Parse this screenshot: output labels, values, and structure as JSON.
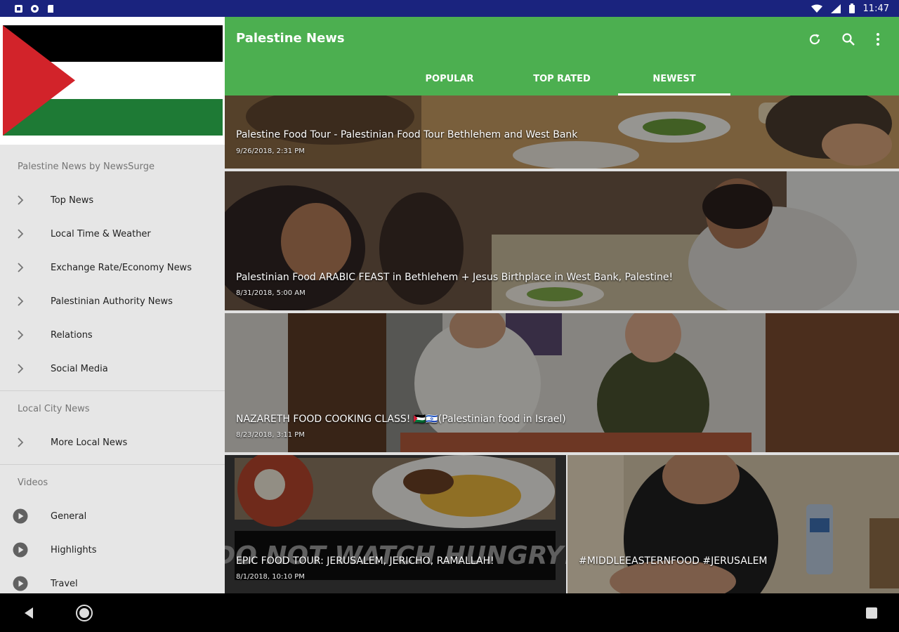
{
  "status_bar": {
    "time": "11:47"
  },
  "drawer": {
    "sections": [
      {
        "title": "Palestine News by NewsSurge",
        "items": [
          "Top News",
          "Local Time & Weather",
          "Exchange Rate/Economy News",
          "Palestinian Authority News",
          "Relations",
          "Social Media"
        ]
      },
      {
        "title": "Local City News",
        "items": [
          "More Local News"
        ]
      },
      {
        "title": "Videos",
        "items": [
          "General",
          "Highlights",
          "Travel"
        ]
      }
    ]
  },
  "app_bar": {
    "title": "Palestine News",
    "tabs": [
      "POPULAR",
      "TOP RATED",
      "NEWEST"
    ],
    "active_tab": "NEWEST",
    "accent": "#4caf50"
  },
  "feed": [
    {
      "title": "Palestine Food Tour - Palestinian Food Tour Bethlehem and West Bank",
      "date": "9/26/2018, 2:31 PM"
    },
    {
      "title": "Palestinian Food   ARABIC FEAST in Bethlehem + Jesus Birthplace in West Bank, Palestine!",
      "date": "8/31/2018, 5:00 AM"
    },
    {
      "title": "NAZARETH FOOD COOKING CLASS! 🇵🇸🇮🇱(Palestinian food in Israel)",
      "date": "8/23/2018, 3:11 PM"
    },
    {
      "title": "EPIC FOOD TOUR: JERUSALEM, JERICHO, RAMALLAH!",
      "date": "8/1/2018, 10:10 PM",
      "image_text": "DO NOT WATCH HUNGRY!"
    },
    {
      "title": "#MIDDLEEASTERNFOOD #JERUSALEM",
      "date": ""
    }
  ],
  "icons": {
    "refresh": "refresh-icon",
    "search": "search-icon",
    "more": "more-vert-icon",
    "chevron": "chevron-right-icon",
    "play": "play-circle-icon"
  }
}
